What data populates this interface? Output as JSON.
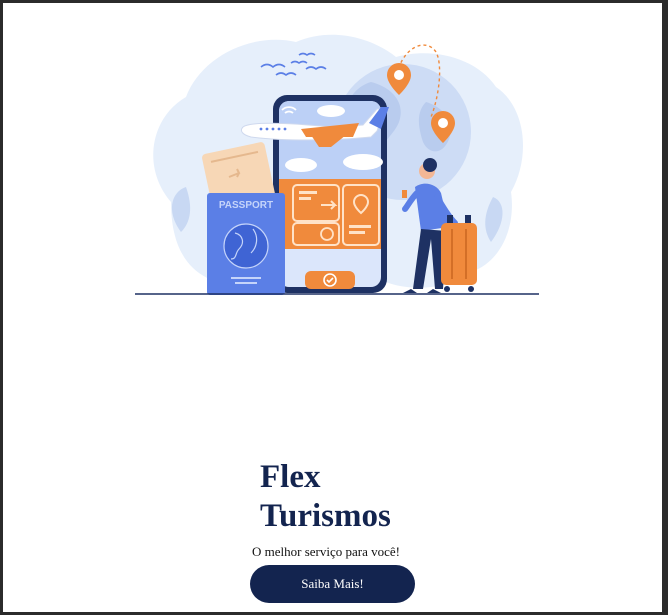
{
  "hero": {
    "title_line1": "Flex",
    "title_line2": "Turismos",
    "subtitle": "O melhor serviço para você!",
    "cta_label": "Saiba Mais!",
    "illustration": {
      "passport_label": "PASSPORT",
      "icons": [
        "airplane-icon",
        "map-pin-icon",
        "wifi-icon",
        "check-icon",
        "bird-icon",
        "suitcase-icon"
      ]
    }
  },
  "colors": {
    "primary": "#13244f",
    "accent_orange": "#f08a3c",
    "illustration_blue": "#5b7fe6",
    "illustration_light": "#e6effb",
    "background": "#ffffff",
    "frame": "#2b2b2b"
  }
}
